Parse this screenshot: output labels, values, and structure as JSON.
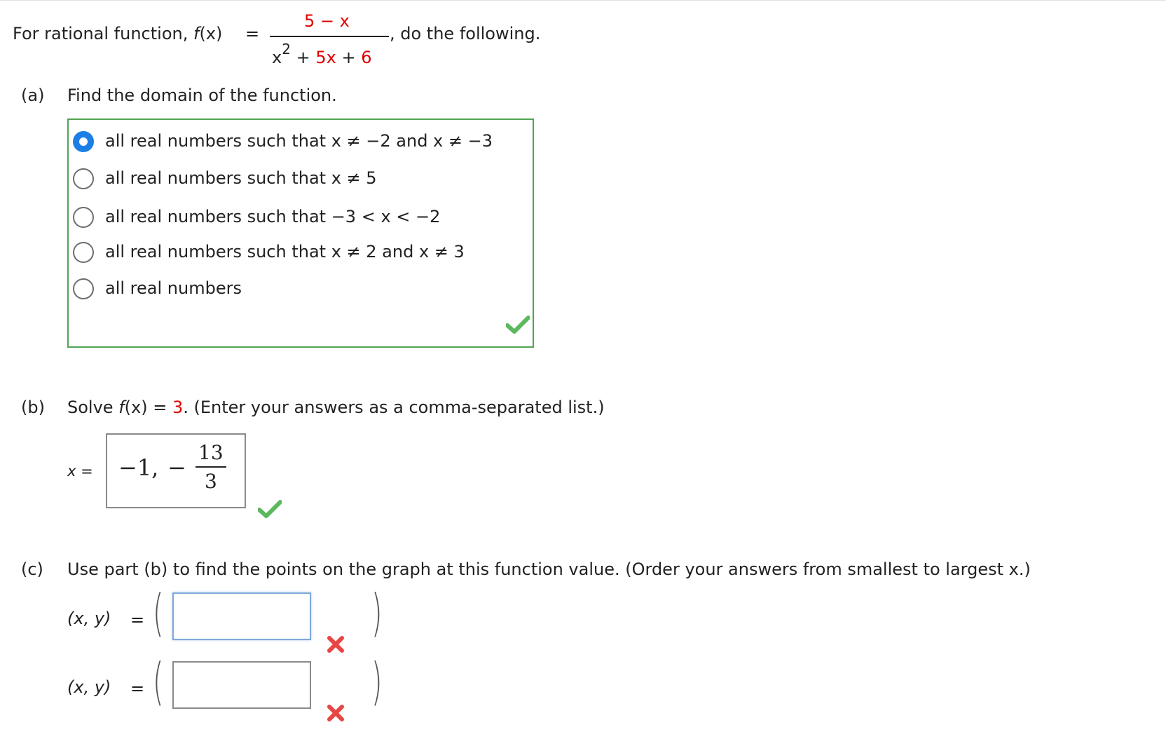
{
  "intro": {
    "prefix": "For rational function, ",
    "fname": "f",
    "fvar": "(x)",
    "equals": "=",
    "numerator": "5 − x",
    "denominator": {
      "x": "x",
      "exp": "2",
      "plus1": "+",
      "term": "5x",
      "plus2": "+",
      "const": "6"
    },
    "suffix": ", do the following."
  },
  "part_a": {
    "label": "(a)",
    "prompt": "Find the domain of the function.",
    "options": [
      "all real numbers such that x ≠ −2 and x ≠ −3",
      "all real numbers such that x ≠ 5",
      "all real numbers such that −3 < x < −2",
      "all real numbers such that x ≠ 2 and x ≠ 3",
      "all real numbers"
    ],
    "selected_index": 0,
    "status_icon": "check-icon"
  },
  "part_b": {
    "label": "(b)",
    "prompt_pre": "Solve ",
    "fname": "f",
    "fvar": "(x)",
    "equals": " = ",
    "value": "3",
    "prompt_post": ". (Enter your answers as a comma-separated list.)",
    "var_label": "x =",
    "answer_first": "−1,",
    "answer_minus": "−",
    "answer_num": "13",
    "answer_den": "3",
    "status_icon": "check-icon"
  },
  "part_c": {
    "label": "(c)",
    "prompt": "Use part (b) to find the points on the graph at this function value. (Order your answers from smallest to largest x.)",
    "rows": [
      {
        "label": "(x, y)",
        "equals": "=",
        "value": "",
        "status_icon": "x-icon"
      },
      {
        "label": "(x, y)",
        "equals": "=",
        "value": "",
        "status_icon": "x-icon"
      }
    ]
  },
  "colors": {
    "correct": "#5cb85c",
    "incorrect": "#e84545",
    "selected_radio": "#1b7fe6",
    "highlight": "#e00000"
  }
}
